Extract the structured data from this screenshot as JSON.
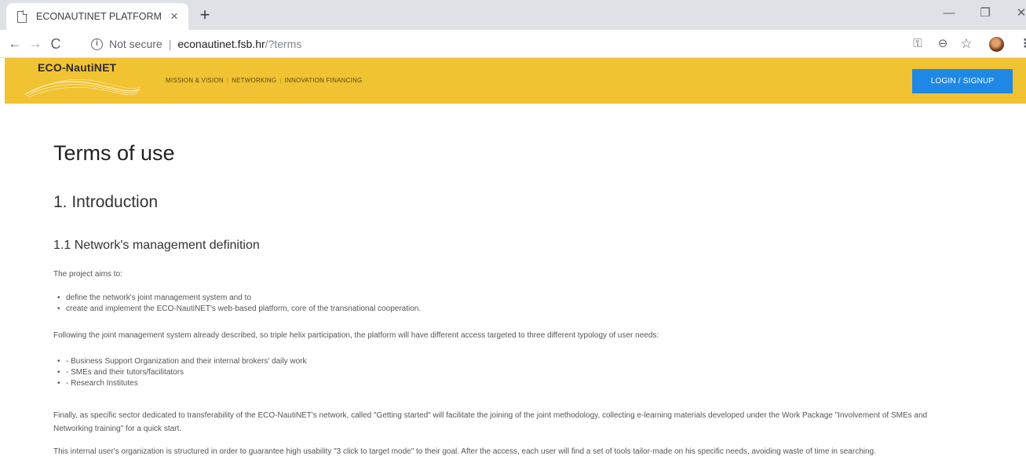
{
  "browser": {
    "tab_title": "ECONAUTINET PLATFORM",
    "tab_close": "×",
    "new_tab": "+",
    "window": {
      "minimize": "—",
      "maximize": "❐",
      "close": "✕"
    },
    "nav": {
      "back": "←",
      "forward": "→",
      "reload": "C"
    },
    "address": {
      "security_label": "Not secure",
      "separator": "|",
      "host": "econautinet.fsb.hr",
      "path": "/?terms"
    },
    "icons": {
      "key": "⚿",
      "zoom": "⊖",
      "star": "☆",
      "menu": "⋮"
    }
  },
  "site": {
    "logo_text": "ECO-NautiNET",
    "nav": [
      "MISSION & VISION",
      "NETWORKING",
      "INNOVATION FINANCING"
    ],
    "nav_separator": "|",
    "login_label": "LOGIN / SIGNUP",
    "header_color": "#f1c232",
    "button_color": "#1e88e5"
  },
  "content": {
    "page_title": "Terms of use",
    "section_title": "1. Introduction",
    "subsection_title": "1.1 Network's management definition",
    "intro": "The project aims to:",
    "aims": [
      "define the network's joint management system and to",
      "create and implement the ECO-NautiNET's web-based platform, core of the transnational cooperation."
    ],
    "access_paragraph": "Following the joint management system already described, so triple helix participation, the platform will have different access targeted to three different typology of user needs:",
    "user_types": [
      "- Business Support Organization and their internal brokers' daily work",
      "- SMEs and their tutors/facilitators",
      "- Research Institutes"
    ],
    "getting_started_paragraph": "Finally, as specific sector dedicated to transferability of the ECO-NautiNET's network, called \"Getting started\" will facilitate the joining of the joint methodology, collecting e-learning materials developed under the Work Package \"Involvement of SMEs and Networking training\" for a quick start.",
    "organization_paragraph": "This internal user's organization is structured in order to guarantee high usability \"3 click to target mode\" to their goal. After the access, each user will find a set of tools tailor-made on his specific needs, avoiding waste of time in searching."
  }
}
